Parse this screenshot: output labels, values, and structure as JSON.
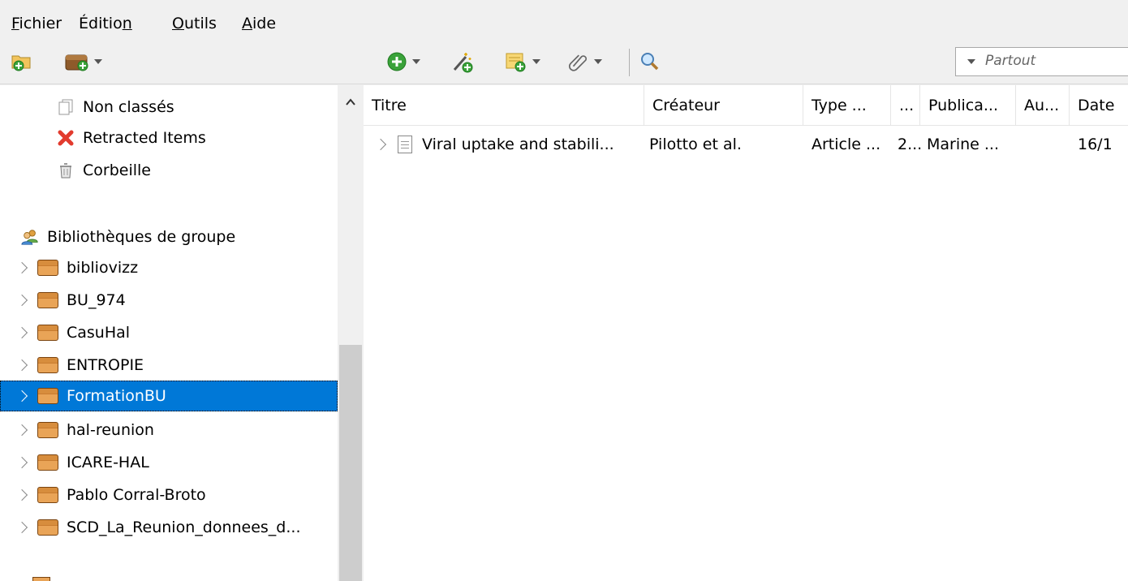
{
  "menu": {
    "fichier": {
      "u": "F",
      "rest": "ichier"
    },
    "edition": {
      "pre": "Éditio",
      "u": "n",
      "rest": ""
    },
    "outils": {
      "u": "O",
      "rest": "utils"
    },
    "aide": {
      "u": "A",
      "rest": "ide"
    }
  },
  "search": {
    "mode": "Partout"
  },
  "left_pane": {
    "special_items": [
      {
        "label": "Non classés",
        "icon": "unfiled-icon"
      },
      {
        "label": "Retracted Items",
        "icon": "retracted-x-icon"
      },
      {
        "label": "Corbeille",
        "icon": "trash-icon"
      }
    ],
    "group_header": "Bibliothèques de groupe",
    "groups": [
      {
        "label": "bibliovizz"
      },
      {
        "label": "BU_974"
      },
      {
        "label": "CasuHal"
      },
      {
        "label": "ENTROPIE"
      },
      {
        "label": "FormationBU",
        "selected": true
      },
      {
        "label": "hal-reunion"
      },
      {
        "label": "ICARE-HAL"
      },
      {
        "label": "Pablo Corral-Broto"
      },
      {
        "label": "SCD_La_Reunion_donnees_d..."
      }
    ]
  },
  "columns": [
    "Titre",
    "Créateur",
    "Type ...",
    "...",
    "Publica...",
    "Au...",
    "Date"
  ],
  "items": [
    {
      "title": "Viral uptake and stabili...",
      "creator": "Pilotto et al.",
      "type": "Article ...",
      "extra": "2...",
      "publication": "Marine ...",
      "author": "",
      "date": "16/1"
    }
  ],
  "colors": {
    "selection": "#0078d7",
    "accent_green": "#3aa23a",
    "folder": "#d78d3d"
  }
}
